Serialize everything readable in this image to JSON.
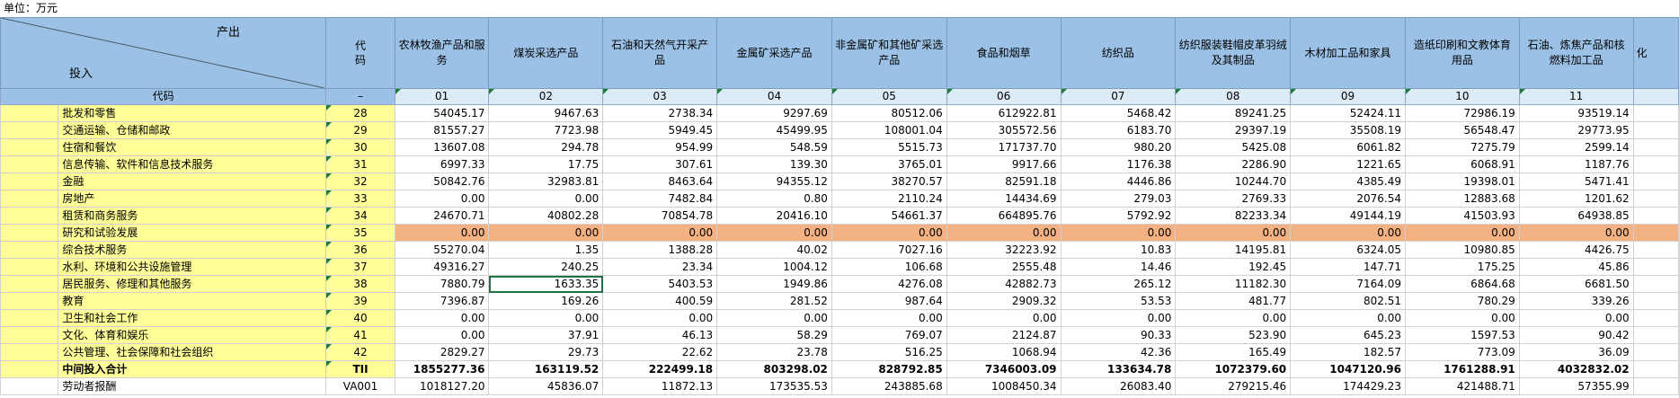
{
  "unit_label": "单位：万元",
  "corner": {
    "output": "产出",
    "input": "投入"
  },
  "code_col_header": "代码",
  "code_row_label": "代码",
  "code_row_code": "–",
  "columns": [
    {
      "name": "农林牧渔产品和服务",
      "code": "01"
    },
    {
      "name": "煤炭采选产品",
      "code": "02"
    },
    {
      "name": "石油和天然气开采产品",
      "code": "03"
    },
    {
      "name": "金属矿采选产品",
      "code": "04"
    },
    {
      "name": "非金属矿和其他矿采选产品",
      "code": "05"
    },
    {
      "name": "食品和烟草",
      "code": "06"
    },
    {
      "name": "纺织品",
      "code": "07"
    },
    {
      "name": "纺织服装鞋帽皮革羽绒及其制品",
      "code": "08"
    },
    {
      "name": "木材加工品和家具",
      "code": "09"
    },
    {
      "name": "造纸印刷和文教体育用品",
      "code": "10"
    },
    {
      "name": "石油、炼焦产品和核燃料加工品",
      "code": "11"
    },
    {
      "name": "化",
      "code": ""
    }
  ],
  "rows": [
    {
      "name": "批发和零售",
      "code": "28",
      "values": [
        "54045.17",
        "9467.63",
        "2738.34",
        "9297.69",
        "80512.06",
        "612922.81",
        "5468.42",
        "89241.25",
        "52424.11",
        "72986.19",
        "93519.14"
      ]
    },
    {
      "name": "交通运输、仓储和邮政",
      "code": "29",
      "values": [
        "81557.27",
        "7723.98",
        "5949.45",
        "45499.95",
        "108001.04",
        "305572.56",
        "6183.70",
        "29397.19",
        "35508.19",
        "56548.47",
        "29773.95"
      ]
    },
    {
      "name": "住宿和餐饮",
      "code": "30",
      "values": [
        "13607.08",
        "294.78",
        "954.99",
        "548.59",
        "5515.73",
        "171737.70",
        "980.20",
        "5425.08",
        "6061.82",
        "7275.79",
        "2599.14"
      ]
    },
    {
      "name": "信息传输、软件和信息技术服务",
      "code": "31",
      "values": [
        "6997.33",
        "17.75",
        "307.61",
        "139.30",
        "3765.01",
        "9917.66",
        "1176.38",
        "2286.90",
        "1221.65",
        "6068.91",
        "1187.76"
      ]
    },
    {
      "name": "金融",
      "code": "32",
      "values": [
        "50842.76",
        "32983.81",
        "8463.64",
        "94355.12",
        "38270.57",
        "82591.18",
        "4446.86",
        "10244.70",
        "4385.49",
        "19398.01",
        "5471.41"
      ]
    },
    {
      "name": "房地产",
      "code": "33",
      "values": [
        "0.00",
        "0.00",
        "7482.84",
        "0.80",
        "2110.24",
        "14434.69",
        "279.03",
        "2769.33",
        "2076.54",
        "12883.68",
        "1201.62"
      ]
    },
    {
      "name": "租赁和商务服务",
      "code": "34",
      "values": [
        "24670.71",
        "40802.28",
        "70854.78",
        "20416.10",
        "54661.37",
        "664895.76",
        "5792.92",
        "82233.34",
        "49144.19",
        "41503.93",
        "64938.85"
      ]
    },
    {
      "name": "研究和试验发展",
      "code": "35",
      "values": [
        "0.00",
        "0.00",
        "0.00",
        "0.00",
        "0.00",
        "0.00",
        "0.00",
        "0.00",
        "0.00",
        "0.00",
        "0.00"
      ],
      "highlight": true
    },
    {
      "name": "综合技术服务",
      "code": "36",
      "values": [
        "55270.04",
        "1.35",
        "1388.28",
        "40.02",
        "7027.16",
        "32223.92",
        "10.83",
        "14195.81",
        "6324.05",
        "10980.85",
        "4426.75"
      ]
    },
    {
      "name": "水利、环境和公共设施管理",
      "code": "37",
      "values": [
        "49316.27",
        "240.25",
        "23.34",
        "1004.12",
        "106.68",
        "2555.48",
        "14.46",
        "192.45",
        "147.71",
        "175.25",
        "45.86"
      ]
    },
    {
      "name": "居民服务、修理和其他服务",
      "code": "38",
      "values": [
        "7880.79",
        "1633.35",
        "5403.53",
        "1949.86",
        "4276.08",
        "42882.73",
        "265.12",
        "11182.30",
        "7164.09",
        "6864.68",
        "6681.50"
      ]
    },
    {
      "name": "教育",
      "code": "39",
      "values": [
        "7396.87",
        "169.26",
        "400.59",
        "281.52",
        "987.64",
        "2909.32",
        "53.53",
        "481.77",
        "802.51",
        "780.29",
        "339.26"
      ]
    },
    {
      "name": "卫生和社会工作",
      "code": "40",
      "values": [
        "0.00",
        "0.00",
        "0.00",
        "0.00",
        "0.00",
        "0.00",
        "0.00",
        "0.00",
        "0.00",
        "0.00",
        "0.00"
      ]
    },
    {
      "name": "文化、体育和娱乐",
      "code": "41",
      "values": [
        "0.00",
        "37.91",
        "46.13",
        "58.29",
        "769.07",
        "2124.87",
        "90.33",
        "523.90",
        "645.23",
        "1597.53",
        "90.42"
      ]
    },
    {
      "name": "公共管理、社会保障和社会组织",
      "code": "42",
      "values": [
        "2829.27",
        "29.73",
        "22.62",
        "23.78",
        "516.25",
        "1068.94",
        "42.36",
        "165.49",
        "182.57",
        "773.09",
        "36.09"
      ]
    },
    {
      "name": "中间投入合计",
      "code": "TII",
      "values": [
        "1855277.36",
        "163119.52",
        "222499.18",
        "803298.02",
        "828792.85",
        "7346003.09",
        "133634.78",
        "1072379.60",
        "1047120.96",
        "1761288.91",
        "4032832.02"
      ],
      "bold": true
    },
    {
      "name": "劳动者报酬",
      "code": "VA001",
      "values": [
        "1018127.20",
        "45836.07",
        "11872.13",
        "173535.53",
        "243885.68",
        "1008450.34",
        "26083.40",
        "279215.46",
        "174429.23",
        "421488.71",
        "57355.99"
      ],
      "va": true
    }
  ],
  "selected_cell": {
    "row": 10,
    "col": 1
  }
}
